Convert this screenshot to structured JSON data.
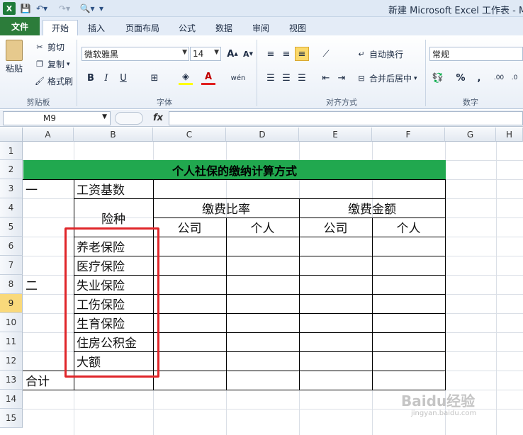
{
  "window": {
    "title": "新建 Microsoft Excel 工作表 - Mi"
  },
  "tabs": [
    "文件",
    "开始",
    "插入",
    "页面布局",
    "公式",
    "数据",
    "审阅",
    "视图"
  ],
  "ribbon": {
    "clipboard": {
      "label": "剪贴板",
      "paste": "粘贴",
      "cut": "剪切",
      "copy": "复制",
      "format_painter": "格式刷"
    },
    "font": {
      "label": "字体",
      "name": "微软雅黑",
      "size": "14"
    },
    "alignment": {
      "label": "对齐方式",
      "wrap": "自动换行",
      "merge": "合并后居中"
    },
    "number": {
      "label": "数字",
      "format": "常规"
    }
  },
  "formula_bar": {
    "name_box": "M9",
    "fx": "fx"
  },
  "columns": [
    "A",
    "B",
    "C",
    "D",
    "E",
    "F",
    "G",
    "H"
  ],
  "rows": [
    "1",
    "2",
    "3",
    "4",
    "5",
    "6",
    "7",
    "8",
    "9",
    "10",
    "11",
    "12",
    "13",
    "14",
    "15"
  ],
  "selected_row": "9",
  "sheet": {
    "title": "个人社保的缴纳计算方式",
    "a3": "一",
    "b3": "工资基数",
    "b4": "险种",
    "ratio_header": "缴费比率",
    "amount_header": "缴费金额",
    "company": "公司",
    "personal": "个人",
    "insurance_types": [
      "养老保险",
      "医疗保险",
      "失业保险",
      "工伤保险",
      "生育保险",
      "住房公积金",
      "大额"
    ],
    "a8": "二",
    "a13": "合计"
  },
  "watermark": {
    "main": "Baidu经验",
    "sub": "jingyan.baidu.com"
  }
}
